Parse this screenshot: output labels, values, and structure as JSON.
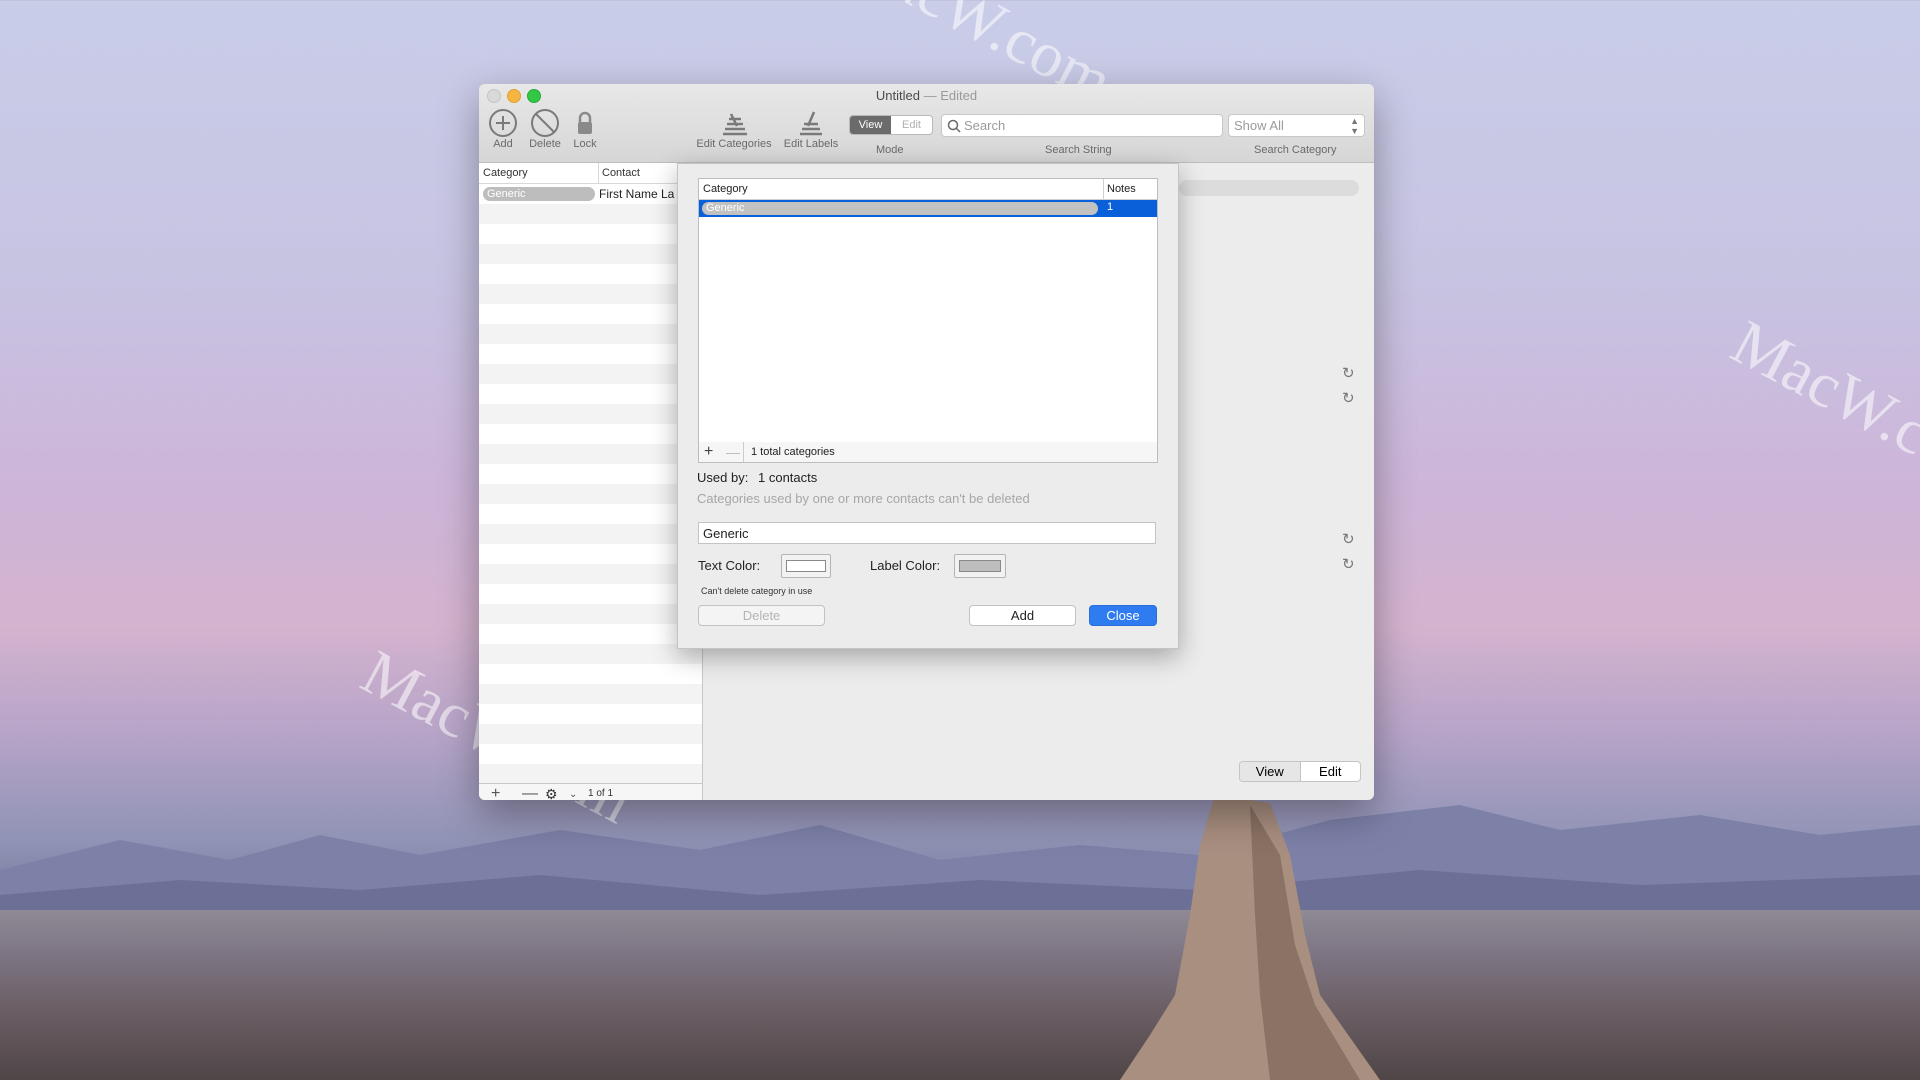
{
  "window": {
    "title": "Untitled",
    "edited_suffix": "— Edited"
  },
  "toolbar": {
    "add_label": "Add",
    "delete_label": "Delete",
    "lock_label": "Lock",
    "edit_categories_label": "Edit Categories",
    "edit_labels_label": "Edit Labels",
    "mode_label": "Mode",
    "mode_view": "View",
    "mode_edit": "Edit",
    "search_placeholder": "Search",
    "search_string_label": "Search String",
    "show_all": "Show All",
    "search_category_label": "Search Category"
  },
  "list": {
    "headers": [
      "Category",
      "Contact"
    ],
    "row": {
      "category": "Generic",
      "contact": "First Name La"
    },
    "count": "1 of 1"
  },
  "dialog": {
    "table_headers": [
      "Category",
      "Notes"
    ],
    "rows": [
      {
        "category": "Generic",
        "notes": "1"
      }
    ],
    "total": "1 total categories",
    "used_by_label": "Used by:",
    "used_by_value": "1 contacts",
    "used_note": "Categories used by one or more contacts can't be deleted",
    "name_value": "Generic",
    "text_color_label": "Text Color:",
    "label_color_label": "Label Color:",
    "cant_delete": "Can't delete category in use",
    "delete_button": "Delete",
    "add_button": "Add",
    "close_button": "Close"
  },
  "bottom_mode": {
    "view": "View",
    "edit": "Edit"
  },
  "watermarks": [
    "MacW.com",
    "MacW.com",
    "MacW.com"
  ],
  "colors": {
    "accent": "#0a60d8",
    "close_button": "#2f7bf0",
    "traffic_red": "#d9d9d9",
    "traffic_yellow": "#f5b541",
    "traffic_green": "#33c748",
    "text_color_swatch": "#ffffff",
    "label_color_swatch": "#bdbdbd"
  }
}
